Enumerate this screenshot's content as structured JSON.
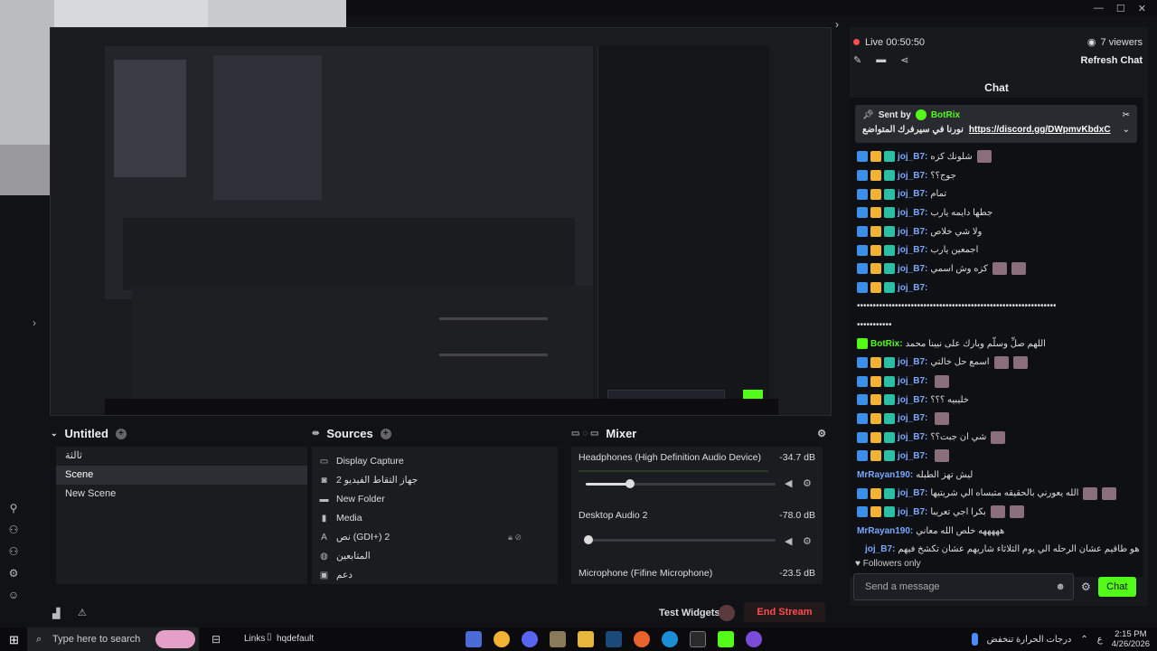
{
  "window": {
    "minimize": "—",
    "maximize": "☐",
    "close": "✕"
  },
  "dock": {
    "scenes": {
      "title": "Untitled",
      "items": [
        "ثالثة",
        "Scene",
        "New Scene"
      ]
    },
    "sources": {
      "title": "Sources",
      "items": [
        {
          "icon": "monitor-icon",
          "label": "Display Capture"
        },
        {
          "icon": "camera-icon",
          "label": "جهاز التقاط الفيديو 2"
        },
        {
          "icon": "folder-icon",
          "label": "New Folder"
        },
        {
          "icon": "media-icon",
          "label": "Media"
        },
        {
          "icon": "text-icon",
          "label": "نص (GDI+) 2"
        },
        {
          "icon": "browser-icon",
          "label": "المتابعين"
        },
        {
          "icon": "image-icon",
          "label": "دعم"
        }
      ]
    },
    "mixer": {
      "title": "Mixer",
      "channels": [
        {
          "name": "Headphones (High Definition Audio Device)",
          "level": "-34.7 dB",
          "volume": 0.23
        },
        {
          "name": "Desktop Audio 2",
          "level": "-78.0 dB",
          "volume": 0.0
        },
        {
          "name": "Microphone (Fifine Microphone)",
          "level": "-23.5 dB"
        }
      ]
    },
    "test_widgets": "Test Widgets",
    "end_stream": "End Stream"
  },
  "chat": {
    "live": "Live 00:50:50",
    "viewers": "7 viewers",
    "refresh": "Refresh Chat",
    "title": "Chat",
    "pinned_sent_by": "Sent by",
    "pinned_user": "BotRix",
    "pinned_text": "نورنا في سيرفرك المتواضع",
    "pinned_link": "https://discord.gg/DWpmvKbdxC",
    "messages": [
      {
        "user": "joj_B7:",
        "text": "شلونك كزه",
        "emotes": 1
      },
      {
        "user": "joj_B7:",
        "text": "جوج؟؟",
        "emotes": 0
      },
      {
        "user": "joj_B7:",
        "text": "تمام",
        "emotes": 0
      },
      {
        "user": "joj_B7:",
        "text": "جطها دايمه يارب",
        "emotes": 0
      },
      {
        "user": "joj_B7:",
        "text": "ولا شي خلاص",
        "emotes": 0
      },
      {
        "user": "joj_B7:",
        "text": "اجمعين يارب",
        "emotes": 0
      },
      {
        "user": "joj_B7:",
        "text": "كزه وش اسمي",
        "emotes": 2
      },
      {
        "user": "joj_B7:",
        "text": "",
        "emotes": 0
      },
      {
        "user": "",
        "text": "•••••••••••••••••••••••••••••••••••••••••••••••••••••••••••••••",
        "emotes": 0
      },
      {
        "user": "",
        "text": "•••••••••••",
        "emotes": 0
      },
      {
        "user": "BotRix:",
        "text": "اللهم صلِّ وسلّم وبارك على نبينا محمد",
        "emotes": 0
      },
      {
        "user": "joj_B7:",
        "text": "اسمع حل خالتي",
        "emotes": 2
      },
      {
        "user": "joj_B7:",
        "text": "",
        "emotes": 1
      },
      {
        "user": "joj_B7:",
        "text": "خليبيه ؟؟؟",
        "emotes": 0
      },
      {
        "user": "joj_B7:",
        "text": "",
        "emotes": 1
      },
      {
        "user": "joj_B7:",
        "text": "شي ان جبت؟؟",
        "emotes": 1
      },
      {
        "user": "joj_B7:",
        "text": "",
        "emotes": 1
      },
      {
        "user": "MrRayan190:",
        "text": "ليش تهز الطبله",
        "emotes": 0
      },
      {
        "user": "joj_B7:",
        "text": "الله يعورني بالحقيقه متبساه الي شريتيها",
        "emotes": 2
      },
      {
        "user": "joj_B7:",
        "text": "بكرا اجي تعريبا",
        "emotes": 2
      },
      {
        "user": "MrRayan190:",
        "text": "هههههه خلص الله معاني",
        "emotes": 0
      },
      {
        "user": "joj_B7:",
        "text": "مر شاري الملابس الي هو طاقيم عشان الرحله الي يوم الثلاثاء شاريهم عشان تكشخ فيهم",
        "emotes": 3
      }
    ],
    "followers_only": "Followers only",
    "placeholder": "Send a message",
    "send": "Chat"
  },
  "taskbar": {
    "search": "Type here to search",
    "links": "Links",
    "file": "hqdefault",
    "weather": "درجات الحرارة تنخفض",
    "lang": "ع",
    "time": "2:15 PM",
    "date": "4/26/2026"
  },
  "colors": {
    "accent": "#53fc18",
    "end_stream": "#ff4d4d",
    "username": "#7aa8ff"
  }
}
